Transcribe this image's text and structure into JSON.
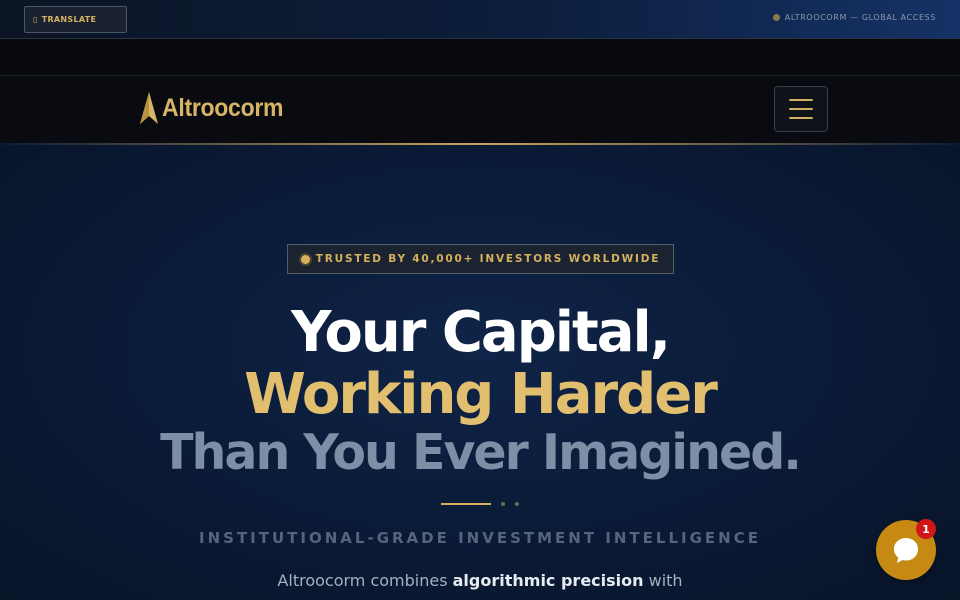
{
  "topbar": {
    "translate_label": "TRANSLATE",
    "translate_icon": "translate-icon",
    "global_access": "ALTROOCORM — GLOBAL ACCESS"
  },
  "navbar": {
    "brand_name": "Altroocorm",
    "menu_icon": "hamburger-icon"
  },
  "hero": {
    "badge": "TRUSTED BY 40,000+ INVESTORS WORLDWIDE",
    "headline_1": "Your Capital,",
    "headline_2": "Working Harder",
    "headline_3": "Than You Ever Imagined.",
    "subtitle": "INSTITUTIONAL-GRADE INVESTMENT INTELLIGENCE",
    "desc_pre": "Altroocorm combines ",
    "desc_bold": "algorithmic precision",
    "desc_post": " with"
  },
  "chat": {
    "icon": "chat-bubble-icon",
    "badge_count": "1"
  },
  "colors": {
    "gold": "#d5b15e",
    "headline_gold": "#e2bf6e",
    "chat": "#c68a14",
    "badge_red": "#d01717"
  }
}
